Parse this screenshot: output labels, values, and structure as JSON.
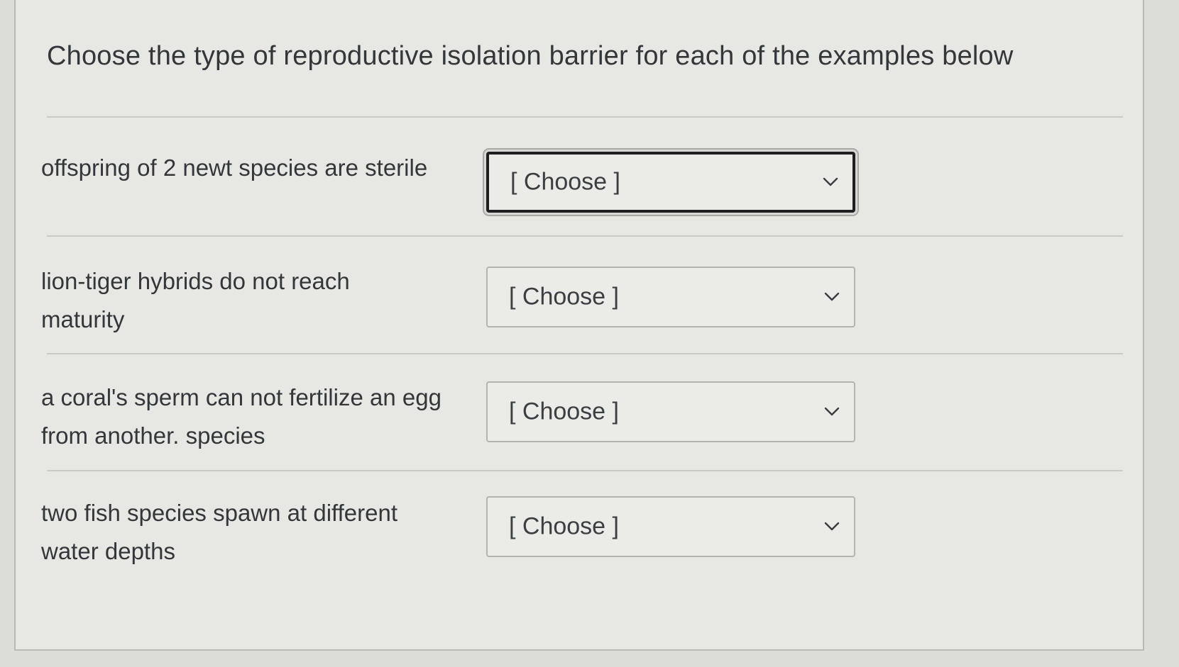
{
  "quiz": {
    "question": "Choose the type of reproductive isolation barrier for each of the examples below",
    "items": [
      {
        "prompt_lines": [
          "offspring of 2 newt species are sterile"
        ],
        "selected": "[ Choose ]"
      },
      {
        "prompt_lines": [
          "lion-tiger hybrids do not reach",
          "maturity"
        ],
        "selected": "[ Choose ]"
      },
      {
        "prompt_lines": [
          "a coral's sperm can not fertilize an egg",
          "from another. species"
        ],
        "selected": "[ Choose ]"
      },
      {
        "prompt_lines": [
          "two fish species spawn at different",
          "water depths"
        ],
        "selected": "[ Choose ]"
      }
    ]
  },
  "icons": {
    "dropdown": "chevron-down-icon"
  },
  "colors": {
    "panel_bg": "#e7e7e4",
    "text": "#34373a",
    "border": "#b3b3b0",
    "focus_border": "#1e1f20"
  }
}
